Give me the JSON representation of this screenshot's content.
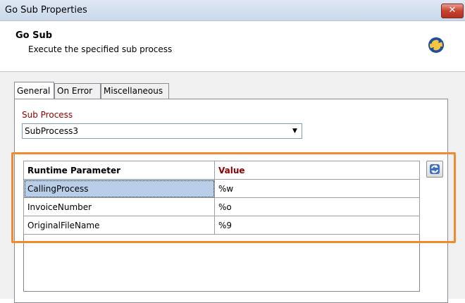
{
  "window": {
    "title": "Go Sub Properties",
    "close_label": "✕"
  },
  "header": {
    "title": "Go Sub",
    "description": "Execute the specified sub process",
    "icon": "process-arrows-icon"
  },
  "tabs": [
    {
      "label": "General",
      "active": true
    },
    {
      "label": "On Error",
      "active": false
    },
    {
      "label": "Miscellaneous",
      "active": false
    }
  ],
  "sub_process": {
    "label": "Sub Process",
    "value": "SubProcess3"
  },
  "grid": {
    "headers": {
      "param": "Runtime Parameter",
      "value": "Value"
    },
    "rows": [
      {
        "param": "CallingProcess",
        "value": "%w"
      },
      {
        "param": "InvoiceNumber",
        "value": "%o"
      },
      {
        "param": "OriginalFileName",
        "value": "%9"
      }
    ]
  },
  "refresh_button": {
    "icon": "refresh-icon"
  },
  "colors": {
    "accent_label": "#8b0000",
    "highlight": "#ef8a2f",
    "selection": "#b9cfe9"
  }
}
